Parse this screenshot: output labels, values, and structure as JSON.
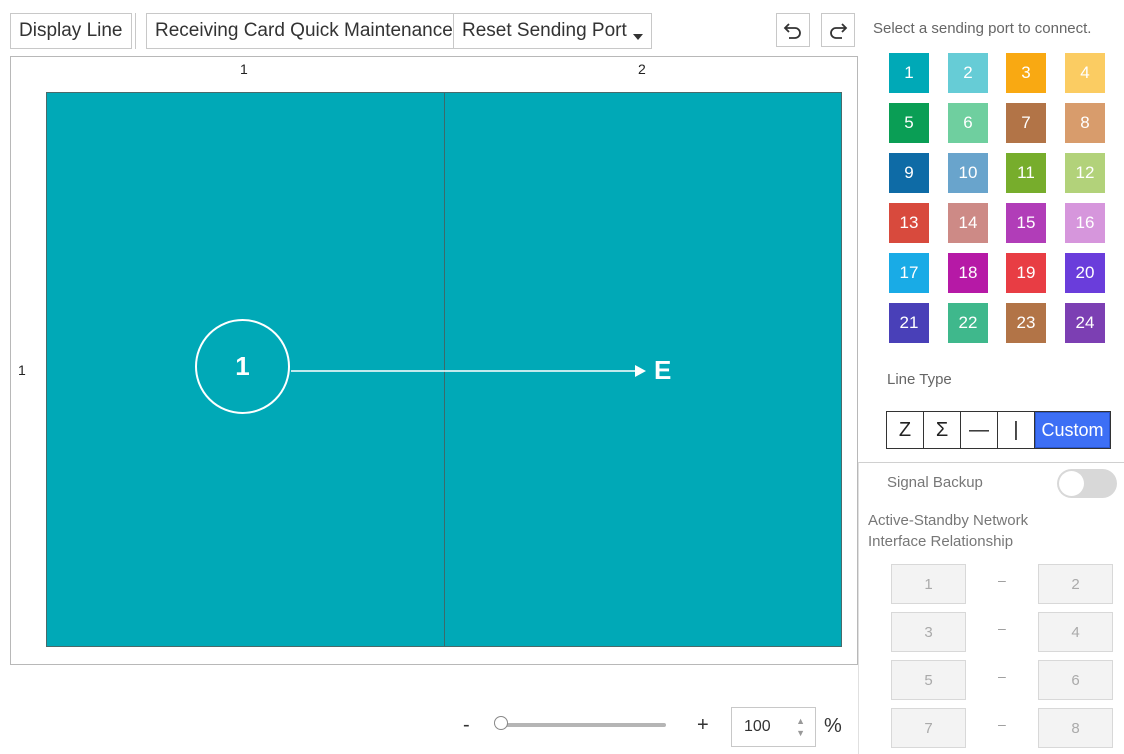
{
  "toolbar": {
    "display_line": "Display Line",
    "quick_maintenance": "Receiving Card Quick Maintenance",
    "reset_port": "Reset Sending Port"
  },
  "canvas": {
    "col_labels": [
      "1",
      "2"
    ],
    "row_labels": [
      "1"
    ],
    "route_start": "1",
    "route_end": "E",
    "screen_color": "#00a9b7"
  },
  "zoom": {
    "minus": "-",
    "plus": "+",
    "value": "100",
    "unit": "%",
    "slider_level": 0.0
  },
  "panel": {
    "title": "Select a sending port to connect.",
    "ports": [
      {
        "label": "1",
        "color": "#00a9b7"
      },
      {
        "label": "2",
        "color": "#66ccd6"
      },
      {
        "label": "3",
        "color": "#f9a912"
      },
      {
        "label": "4",
        "color": "#fbcc62"
      },
      {
        "label": "5",
        "color": "#0a9e55"
      },
      {
        "label": "6",
        "color": "#6fcf9f"
      },
      {
        "label": "7",
        "color": "#b27447"
      },
      {
        "label": "8",
        "color": "#d89c6c"
      },
      {
        "label": "9",
        "color": "#0e6ba6"
      },
      {
        "label": "10",
        "color": "#69a4cc"
      },
      {
        "label": "11",
        "color": "#77ad2c"
      },
      {
        "label": "12",
        "color": "#b2d27a"
      },
      {
        "label": "13",
        "color": "#d84a3d"
      },
      {
        "label": "14",
        "color": "#cd8a86"
      },
      {
        "label": "15",
        "color": "#b13db8"
      },
      {
        "label": "16",
        "color": "#d696dc"
      },
      {
        "label": "17",
        "color": "#19abe6"
      },
      {
        "label": "18",
        "color": "#b619a6"
      },
      {
        "label": "19",
        "color": "#e83d44"
      },
      {
        "label": "20",
        "color": "#6a3ddb"
      },
      {
        "label": "21",
        "color": "#4940b8"
      },
      {
        "label": "22",
        "color": "#3fb88c"
      },
      {
        "label": "23",
        "color": "#b27447"
      },
      {
        "label": "24",
        "color": "#7c3fb3"
      }
    ],
    "line_type_label": "Line Type",
    "line_types": [
      "Z",
      "Σ",
      "—",
      "|"
    ],
    "custom_label": "Custom",
    "signal_backup_label": "Signal Backup",
    "signal_backup_on": false,
    "active_standby_label": "Active-Standby Network Interface Relationship",
    "pairs": [
      {
        "left": "1",
        "dash": "–",
        "right": "2"
      },
      {
        "left": "3",
        "dash": "–",
        "right": "4"
      },
      {
        "left": "5",
        "dash": "–",
        "right": "6"
      },
      {
        "left": "7",
        "dash": "–",
        "right": "8"
      }
    ]
  }
}
